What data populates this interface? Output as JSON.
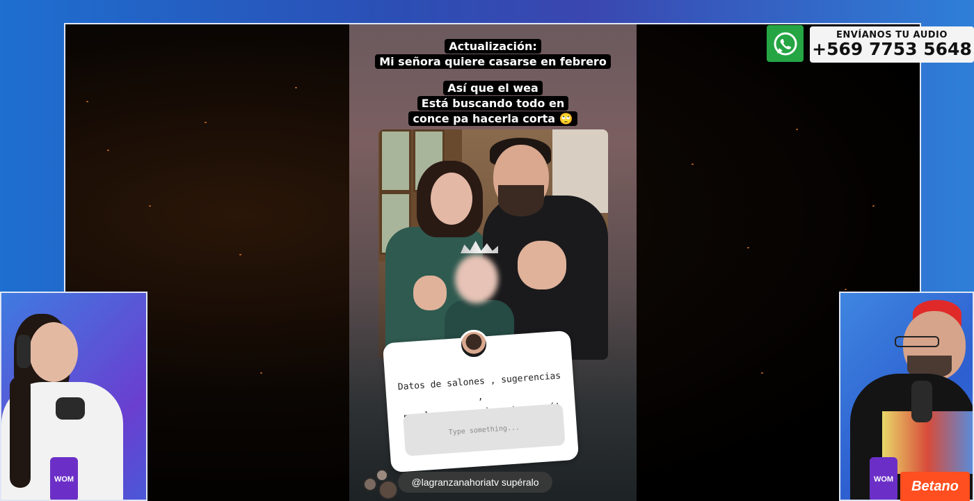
{
  "story": {
    "caption_title": "Actualización:",
    "caption_subtitle": "Mi señora quiere casarse en febrero",
    "caption_line1": "Así que el wea",
    "caption_line2": "Está buscando todo en",
    "caption_line3": "conce pa hacerla corta 🙄",
    "question_line1": "Datos de salones , sugerencias ,",
    "question_line2": "regalos , consejos etc , acá!",
    "question_placeholder": "Type something...",
    "mention": "@lagranzanahoriatv supéralo"
  },
  "whatsapp": {
    "label": "ENVÍANOS TU AUDIO",
    "number": "+569 7753 5648",
    "icon": "whatsapp-icon",
    "color": "#25a544"
  },
  "sponsors": {
    "wom": "WOM",
    "betano": "Betano"
  },
  "colors": {
    "wom_purple": "#6b2fc7",
    "betano_orange": "#ff4e1f"
  }
}
